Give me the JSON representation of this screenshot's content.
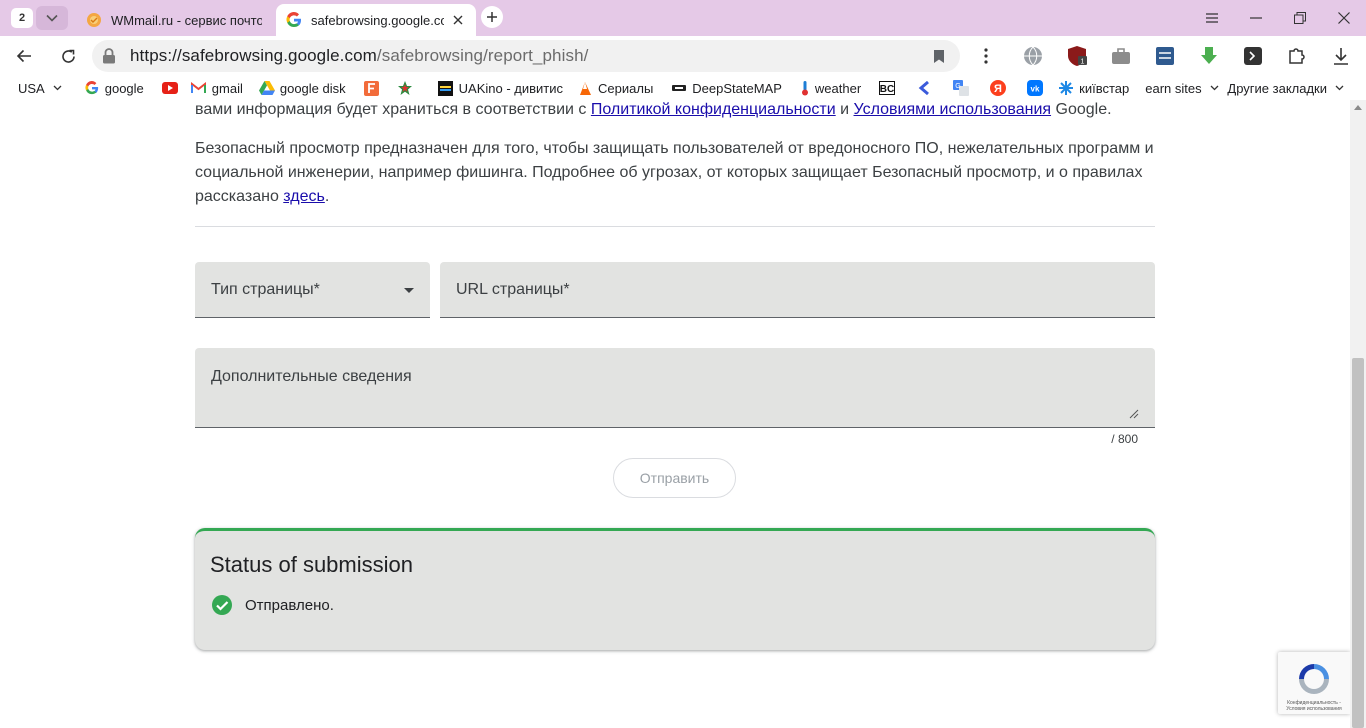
{
  "tabstrip": {
    "tab_count": "2",
    "tabs": [
      {
        "title": "WMmail.ru - сервис почтовых рассылок",
        "active": false
      },
      {
        "title": "safebrowsing.google.com",
        "active": true
      }
    ]
  },
  "toolbar": {
    "url_host": "https://safebrowsing.google.com",
    "url_path": "/safebrowsing/report_phish/"
  },
  "bookmarks": {
    "items": [
      {
        "label": "USA",
        "icon": "dropdown"
      },
      {
        "label": "google",
        "icon": "google-icon"
      },
      {
        "label": "",
        "icon": "youtube-icon"
      },
      {
        "label": "gmail",
        "icon": "gmail-icon"
      },
      {
        "label": "google disk",
        "icon": "google-drive-icon"
      },
      {
        "label": "",
        "icon": "f-icon"
      },
      {
        "label": "",
        "icon": "star-icon"
      },
      {
        "label": "UAKino - дивитис",
        "icon": "uakino-icon"
      },
      {
        "label": "Сериалы",
        "icon": "fox-icon"
      },
      {
        "label": "DeepStateMAP",
        "icon": "map-icon"
      },
      {
        "label": "weather",
        "icon": "thermometer-icon"
      },
      {
        "label": "",
        "icon": "bc-icon"
      },
      {
        "label": "",
        "icon": "chevron-icon"
      },
      {
        "label": "",
        "icon": "translate-icon"
      },
      {
        "label": "",
        "icon": "yandex-icon"
      },
      {
        "label": "",
        "icon": "vk-icon"
      },
      {
        "label": "київстар",
        "icon": "kyivstar-icon"
      },
      {
        "label": "earn sites",
        "icon": "folder"
      }
    ],
    "other": "Другие закладки"
  },
  "page": {
    "para1_prefix": "вами информация будет храниться в соответствии с ",
    "para1_link1": "Политикой конфиденциальности",
    "para1_and": " и ",
    "para1_link2": "Условиями использования",
    "para1_suffix": " Google.",
    "para2_text": "Безопасный просмотр предназначен для того, чтобы защищать пользователей от вредоносного ПО, нежелательных программ и социальной инженерии, например фишинга. Подробнее об угрозах, от которых защищает Безопасный просмотр, и о правилах рассказано ",
    "para2_link": "здесь",
    "para2_end": ".",
    "form": {
      "page_type_label": "Тип страницы*",
      "url_label": "URL страницы*",
      "details_label": "Дополнительные сведения",
      "counter": "/ 800",
      "submit_label": "Отправить"
    },
    "status": {
      "title": "Status of submission",
      "message": "Отправлено."
    },
    "recaptcha_text": "Конфиденциальность - Условия использования"
  },
  "colors": {
    "tabstrip_bg": "#e5c9e7",
    "field_bg": "#e2e3e1",
    "success_green": "#34a853",
    "link_blue": "#1a0dab"
  }
}
